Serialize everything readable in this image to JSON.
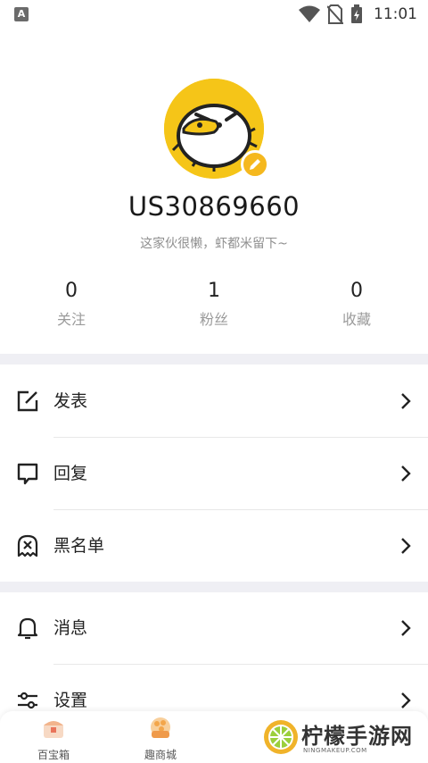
{
  "status_bar": {
    "left_icon_letter": "A",
    "time": "11:01"
  },
  "profile": {
    "username": "US30869660",
    "bio": "这家伙很懒，虾都米留下~",
    "accent_color": "#f5c518"
  },
  "stats": [
    {
      "value": "0",
      "label": "关注"
    },
    {
      "value": "1",
      "label": "粉丝"
    },
    {
      "value": "0",
      "label": "收藏"
    }
  ],
  "menu": {
    "post": {
      "label": "发表",
      "icon": "edit-square-icon"
    },
    "reply": {
      "label": "回复",
      "icon": "speech-bubble-icon"
    },
    "blacklist": {
      "label": "黑名单",
      "icon": "ghost-x-icon"
    },
    "messages": {
      "label": "消息",
      "icon": "bell-icon"
    },
    "settings": {
      "label": "设置",
      "icon": "sliders-icon"
    }
  },
  "bottom_nav": [
    {
      "label": "百宝箱",
      "icon": "treasure-chest-icon"
    },
    {
      "label": "趣商城",
      "icon": "shop-basket-icon"
    }
  ],
  "watermark": {
    "text": "柠檬手游网",
    "sub": "NINGMAKEUP.COM"
  }
}
